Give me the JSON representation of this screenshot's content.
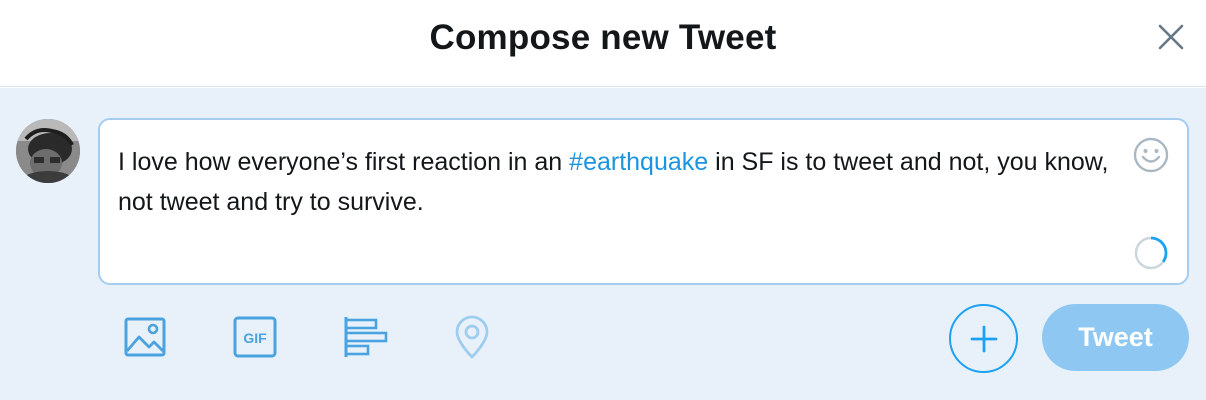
{
  "dialog": {
    "title": "Compose new Tweet"
  },
  "composer": {
    "text_before": "I love how everyone’s first reaction in an ",
    "hashtag": "#earthquake",
    "text_after": " in SF is to tweet and not, you know, not tweet and try to survive.",
    "character_progress": 0.35
  },
  "toolbar": {
    "icons": [
      "image-icon",
      "gif-icon",
      "poll-icon",
      "location-icon"
    ],
    "gif_label": "GIF",
    "add_icon": "plus-icon",
    "tweet_label": "Tweet"
  },
  "colors": {
    "accent": "#1da1f2",
    "link": "#1b95e0",
    "tweet_button": "#8ec8f2",
    "toolbar_icon": "#4aa3df",
    "background": "#e8f1f9"
  }
}
